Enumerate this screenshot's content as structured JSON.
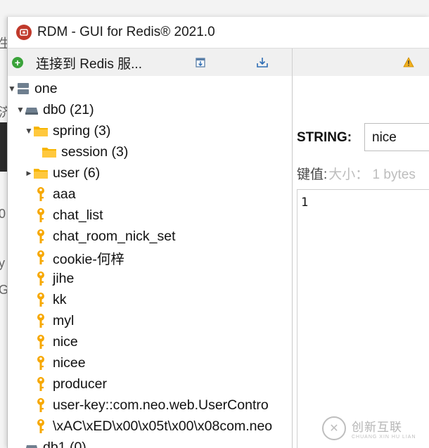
{
  "window": {
    "title": "RDM - GUI for Redis® 2021.0",
    "accent": "#c0392b"
  },
  "toolbar": {
    "connect_label": "连接到 Redis 服...",
    "connect_icon": "plus-circle-icon",
    "import_icon": "import-config-icon",
    "export_icon": "export-config-icon",
    "warning_icon": "warning-icon"
  },
  "tree": {
    "nodes": [
      {
        "label": "one",
        "type": "server",
        "expanded": true
      },
      {
        "label": "db0  (21)",
        "type": "database",
        "expanded": true
      },
      {
        "label": "spring (3)",
        "type": "folder",
        "expanded": true
      },
      {
        "label": "session (3)",
        "type": "folder"
      },
      {
        "label": "user (6)",
        "type": "folder",
        "expanded": false
      },
      {
        "label": "aaa",
        "type": "key"
      },
      {
        "label": "chat_list",
        "type": "key"
      },
      {
        "label": "chat_room_nick_set",
        "type": "key"
      },
      {
        "label": "cookie-何梓",
        "type": "key"
      },
      {
        "label": "jihe",
        "type": "key"
      },
      {
        "label": "kk",
        "type": "key"
      },
      {
        "label": "myl",
        "type": "key"
      },
      {
        "label": "nice",
        "type": "key"
      },
      {
        "label": "nicee",
        "type": "key"
      },
      {
        "label": "producer",
        "type": "key"
      },
      {
        "label": "user-key::com.neo.web.UserContro",
        "type": "key"
      },
      {
        "label": "\\xAC\\xED\\x00\\x05t\\x00\\x08com.neo",
        "type": "key"
      },
      {
        "label": "db1  (0)",
        "type": "database"
      }
    ]
  },
  "panel": {
    "type_label": "STRING:",
    "key_name": "nice",
    "key_value_label": "键值:",
    "size_label": "大小：  1 bytes",
    "value": "1"
  },
  "watermark": {
    "cn": "创新互联",
    "en": "CHUANG XIN HU LIAN",
    "logo": "chuangxin-logo-icon"
  },
  "background": {
    "fragments": [
      "生",
      "济",
      "0",
      "y",
      "G"
    ]
  }
}
